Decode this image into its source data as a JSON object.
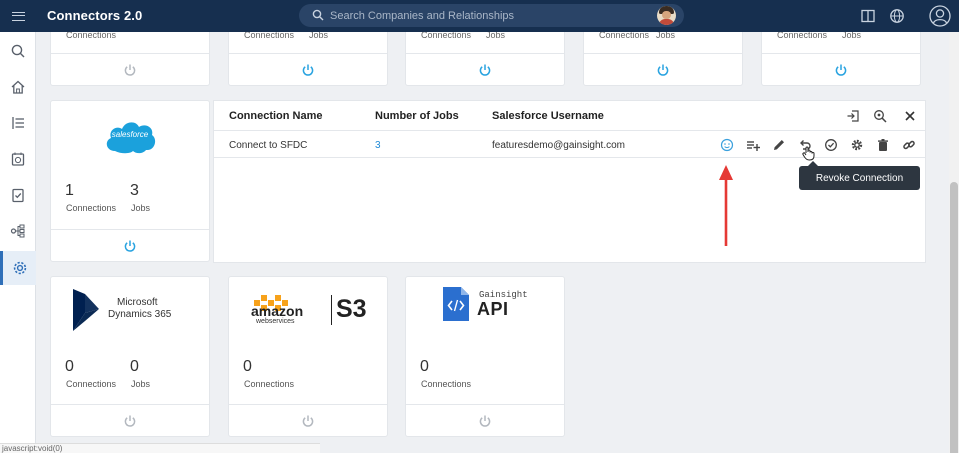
{
  "app": {
    "title": "Connectors 2.0"
  },
  "search": {
    "placeholder": "Search Companies and Relationships"
  },
  "top_cards": [
    {
      "label1": "Connections",
      "label2": ""
    },
    {
      "label1": "Connections",
      "label2": "Jobs"
    },
    {
      "label1": "Connections",
      "label2": "Jobs"
    },
    {
      "label1": "Connections",
      "label2": "Jobs"
    },
    {
      "label1": "Connections",
      "label2": "Jobs"
    }
  ],
  "salesforce": {
    "logo_text": "salesforce",
    "connections_count": "1",
    "jobs_count": "3",
    "connections_label": "Connections",
    "jobs_label": "Jobs"
  },
  "connection_table": {
    "headers": [
      "Connection Name",
      "Number of Jobs",
      "Salesforce Username"
    ],
    "rows": [
      {
        "name": "Connect to SFDC",
        "jobs": "3",
        "username": "featuresdemo@gainsight.com"
      }
    ],
    "tooltip": "Revoke Connection"
  },
  "dynamics": {
    "logo_line1": "Microsoft",
    "logo_line2": "Dynamics 365",
    "connections_count": "0",
    "jobs_count": "0",
    "connections_label": "Connections",
    "jobs_label": "Jobs"
  },
  "s3": {
    "logo_line1": "amazon",
    "logo_line2": "webservices",
    "logo_s3": "S3",
    "connections_count": "0",
    "connections_label": "Connections"
  },
  "gainsight_api": {
    "logo_line1": "Gainsight",
    "logo_line2": "API",
    "connections_count": "0",
    "connections_label": "Connections"
  },
  "status_bar": {
    "text": "javascript:void(0)"
  },
  "colors": {
    "topbar": "#162f4f",
    "accent": "#1f8ad6",
    "active_power": "#29a3e0",
    "arrow": "#e53935"
  }
}
